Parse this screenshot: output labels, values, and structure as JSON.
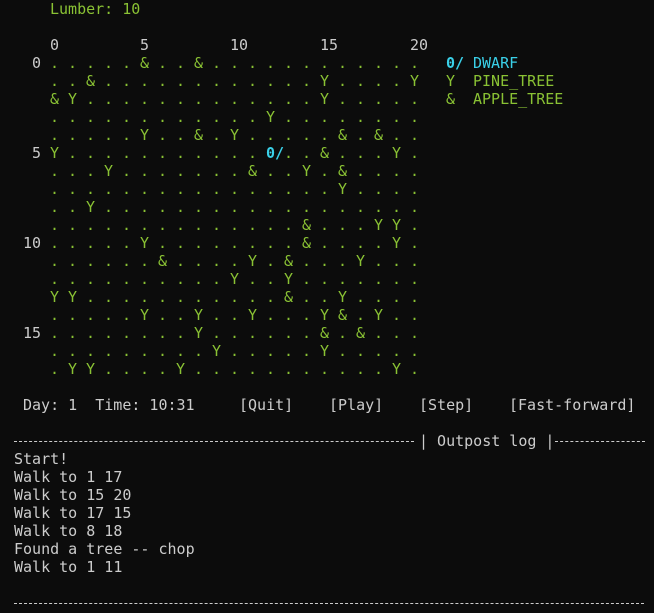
{
  "resources": {
    "lumber_label": "Lumber: 10"
  },
  "map": {
    "col_ticks": [
      "0",
      "5",
      "10",
      "15",
      "20"
    ],
    "row_ticks": [
      "0",
      "5",
      "10",
      "15"
    ],
    "rows": [
      ". . . . . & . . & . . . . . . . . . . . .",
      ". . & . . . . . . . . . . . . Y . . . . Y",
      "& Y . . . . . . . . . . . . . Y . . . . .",
      ". . . . . . . . . . . . Y . . . . . . . .",
      ". . . . . Y . . & . Y . . . . . & . & . .",
      "Y . . . . . . . . . . . 0/ . . & . . . Y .",
      ". . . Y . . . . . . . & . . Y . & . . . .",
      ". . . . . . . . . . . . . . . . Y . . . .",
      ". . Y . . . . . . . . . . . . . . . . . .",
      ". . . . . . . . . . . . . . & . . . Y Y .",
      ". . . . . Y . . . . . . . . & . . . . Y .",
      ". . . . . . & . . . . Y . & . . . Y . . .",
      ". . . . . . . . . . Y . . Y . . . . . . .",
      "Y Y . . . . . . . . . . . & . . Y . . . .",
      ". . . . . Y . . Y . . Y . . . Y & . Y . .",
      ". . . . . . . . Y . . . . . . & . & . . .",
      ". . . . . . . . . Y . . . . . Y . . . . .",
      ". Y Y . . . . Y . . . . . . . . . . . Y ."
    ]
  },
  "legend": [
    {
      "symbol": "0/",
      "label": "DWARF",
      "color": "#3ad0e8"
    },
    {
      "symbol": "Y",
      "label": "PINE_TREE",
      "color": "#8ac234"
    },
    {
      "symbol": "&",
      "label": "APPLE_TREE",
      "color": "#8ac234"
    }
  ],
  "status": {
    "day_time": "Day: 1  Time: 10:31"
  },
  "controls": {
    "quit": "[Quit]",
    "play": "[Play]",
    "step": "[Step]",
    "fast_forward": "[Fast-forward]"
  },
  "log": {
    "title": "| Outpost log |",
    "entries": [
      "Start!",
      "Walk to 1 17",
      "Walk to 15 20",
      "Walk to 17 15",
      "Walk to 8 18",
      "Found a tree -- chop",
      "Walk to 1 11"
    ]
  }
}
